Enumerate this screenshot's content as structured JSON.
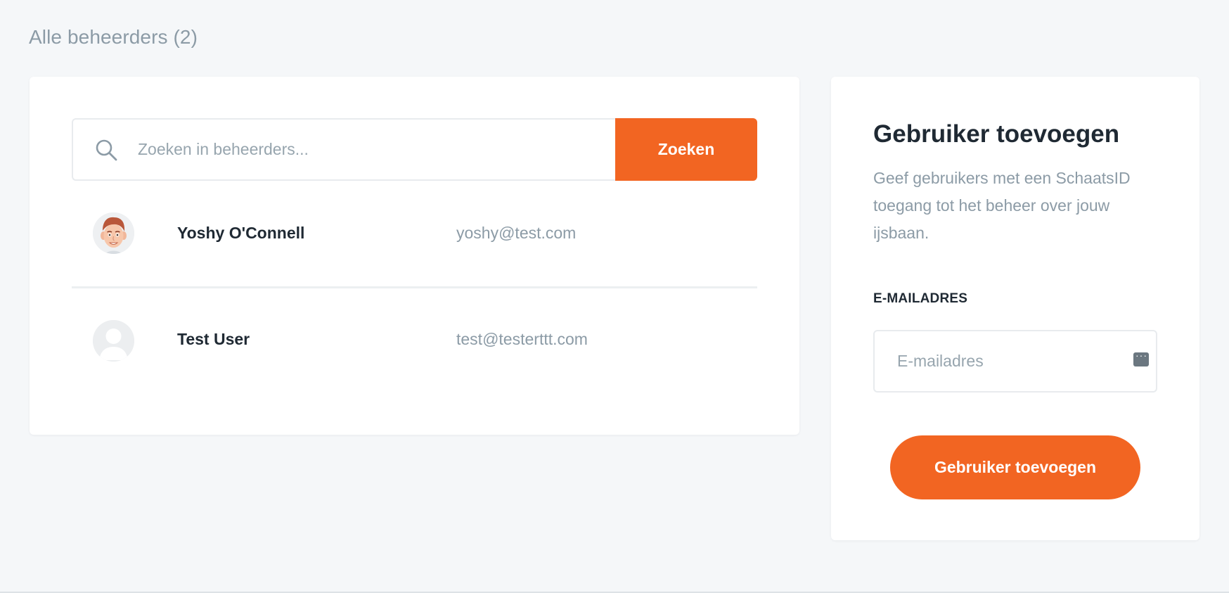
{
  "page": {
    "title": "Alle beheerders (2)"
  },
  "search": {
    "placeholder": "Zoeken in beheerders...",
    "value": "",
    "button_label": "Zoeken",
    "icon": "search-icon"
  },
  "admins": [
    {
      "name": "Yoshy O'Connell",
      "email": "yoshy@test.com",
      "avatar": "memoji-avatar"
    },
    {
      "name": "Test User",
      "email": "test@testerttt.com",
      "avatar": "default-user-avatar"
    }
  ],
  "add_user": {
    "title": "Gebruiker toevoegen",
    "description": "Geef gebruikers met een SchaatsID toegang tot het beheer over jouw ijsbaan.",
    "email_label": "E-MAILADRES",
    "email_placeholder": "E-mailadres",
    "email_value": "",
    "button_label": "Gebruiker toevoegen"
  },
  "colors": {
    "accent": "#f26522",
    "background": "#f5f7f9",
    "muted_text": "#8c9ba6",
    "dark_text": "#1f2933"
  }
}
